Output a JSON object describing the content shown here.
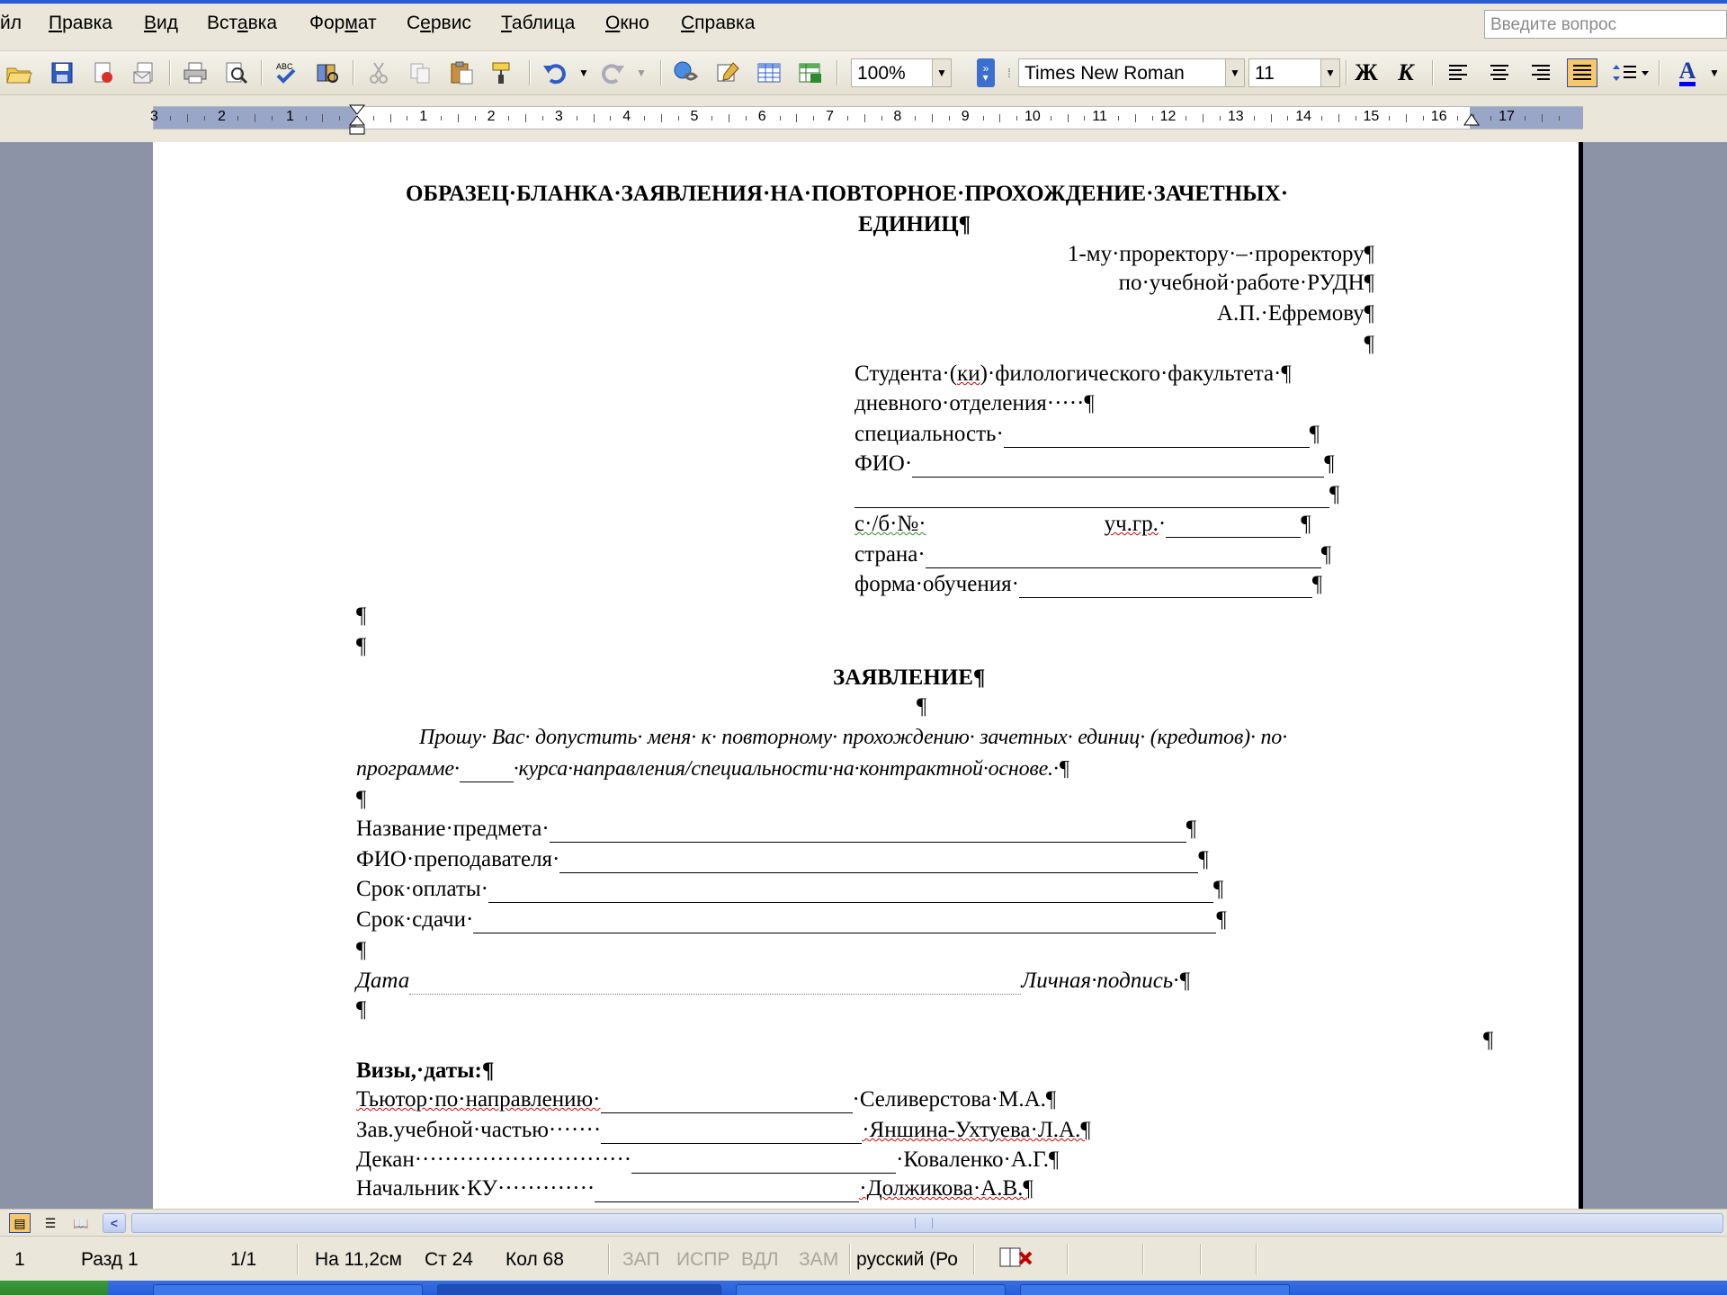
{
  "menu": {
    "items": [
      {
        "label": "йл",
        "hotkey_char": ""
      },
      {
        "pre": "",
        "hot": "П",
        "post": "равка"
      },
      {
        "pre": "",
        "hot": "В",
        "post": "ид"
      },
      {
        "pre": "Вст",
        "hot": "а",
        "post": "вка"
      },
      {
        "pre": "Фор",
        "hot": "м",
        "post": "ат"
      },
      {
        "pre": "С",
        "hot": "е",
        "post": "рвис"
      },
      {
        "pre": "",
        "hot": "Т",
        "post": "аблица"
      },
      {
        "pre": "",
        "hot": "О",
        "post": "кно"
      },
      {
        "pre": "",
        "hot": "С",
        "post": "правка"
      }
    ],
    "help_placeholder": "Введите вопрос"
  },
  "toolbar": {
    "zoom": "100%",
    "font_name": "Times New Roman",
    "font_size": "11",
    "bold_label": "Ж",
    "italic_label": "К",
    "font_color_label": "A",
    "spell_label": "ABC"
  },
  "ruler": {
    "left_numbers": [
      "3",
      "2",
      "1"
    ],
    "right_numbers": [
      "1",
      "2",
      "3",
      "4",
      "5",
      "6",
      "7",
      "8",
      "9",
      "10",
      "11",
      "12",
      "13",
      "14",
      "15",
      "16",
      "17"
    ]
  },
  "document": {
    "title_line1": "ОБРАЗЕЦ·БЛАНКА·ЗАЯВЛЕНИЯ·НА·ПОВТОРНОЕ·ПРОХОЖДЕНИЕ·ЗАЧЕТНЫХ·",
    "title_line2": "ЕДИНИЦ¶",
    "addressee": [
      "1-му·проректору·–·проректору¶",
      "по·учебной·работе·РУДН¶",
      "А.П.·Ефремову¶",
      "¶"
    ],
    "student": {
      "line1_pre": "Студента·(",
      "line1_wavy": "ки",
      "line1_post": ")·филологического·факультета·¶",
      "line2": "дневного·отделения·····¶",
      "specialty_label": "специальность·",
      "fio_label": "ФИО·",
      "cb_label": "с·/б·№·",
      "group_label": "уч.гр.",
      "country_label": "страна·",
      "form_label": "форма·обучения·",
      "pilcrow": "¶"
    },
    "blank_pilcrows": [
      "¶",
      "¶"
    ],
    "heading": "ЗАЯВЛЕНИЕ¶",
    "heading_after": "¶",
    "request_line1": "Прошу· Вас· допустить· меня· к· повторному· прохождению· зачетных· единиц· (кредитов)· по·",
    "request_line2_pre": "программе·",
    "request_line2_post": "·курса·направления/специальности·на·контрактной·основе.·¶",
    "fields": [
      {
        "label": "Название·предмета·",
        "end": "¶"
      },
      {
        "label": "ФИО·преподавателя·",
        "end": "¶"
      },
      {
        "label": "Срок·оплаты·",
        "end": "¶"
      },
      {
        "label": "Срок·сдачи·",
        "end": "¶"
      }
    ],
    "para_after_fields": "¶",
    "date_label": "Дата",
    "signature_label": "Личная·подпись·¶",
    "para_after_date": "¶",
    "para_right": "¶",
    "visas_heading": "Визы,·даты:¶",
    "visas": [
      {
        "role": "Тьютор·по·направлению·",
        "name": "·Селиверстова·М.А.¶"
      },
      {
        "role": "Зав.учебной·частью·······",
        "name": "·Яншина-Ухтуева·Л.А.¶"
      },
      {
        "role": "Декан·····························",
        "name": "·Коваленко·А.Г.¶"
      },
      {
        "role": "Начальник·КУ·············",
        "name": "·Должикова·А.В.¶"
      }
    ]
  },
  "statusbar": {
    "page": "1",
    "section": "Разд  1",
    "pages": "1/1",
    "position": "На 11,2см",
    "line": "Ст  24",
    "col": "Кол  68",
    "rec": "ЗАП",
    "trk": "ИСПР",
    "ext": "ВДЛ",
    "ovr": "ЗАМ",
    "language": "русский (Ро"
  }
}
